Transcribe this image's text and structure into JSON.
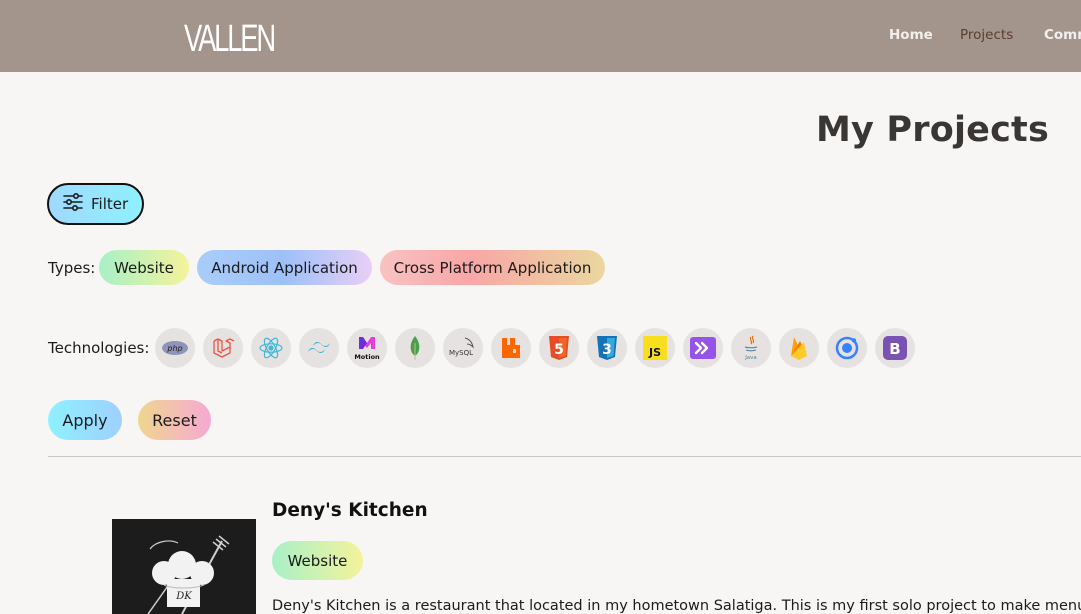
{
  "brand": {
    "logo_text": "VALLEN"
  },
  "nav": {
    "items": [
      {
        "label": "Home",
        "active": false
      },
      {
        "label": "Projects",
        "active": true
      },
      {
        "label": "Comm",
        "active": false
      }
    ]
  },
  "page": {
    "title": "My Projects"
  },
  "filter": {
    "button_label": "Filter",
    "types_label": "Types:",
    "types": [
      {
        "label": "Website"
      },
      {
        "label": "Android Application"
      },
      {
        "label": "Cross Platform Application"
      }
    ],
    "technologies_label": "Technologies:",
    "technologies": [
      {
        "icon": "php-icon",
        "text": "php"
      },
      {
        "icon": "laravel-icon"
      },
      {
        "icon": "react-icon"
      },
      {
        "icon": "tailwind-icon"
      },
      {
        "icon": "motion-icon",
        "text": "Motion"
      },
      {
        "icon": "mongodb-icon"
      },
      {
        "icon": "mysql-icon",
        "text": "MySQL"
      },
      {
        "icon": "rabbitmq-icon"
      },
      {
        "icon": "html5-icon",
        "text": "5"
      },
      {
        "icon": "css3-icon",
        "text": "3"
      },
      {
        "icon": "javascript-icon",
        "text": "JS"
      },
      {
        "icon": "inertia-icon"
      },
      {
        "icon": "java-icon",
        "text": "Java"
      },
      {
        "icon": "firebase-icon"
      },
      {
        "icon": "ionic-icon"
      },
      {
        "icon": "bootstrap-icon",
        "text": "B"
      }
    ],
    "apply_label": "Apply",
    "reset_label": "Reset"
  },
  "projects": [
    {
      "title": "Deny's Kitchen",
      "type": "Website",
      "thumbnail_text": "DK",
      "description": "Deny's Kitchen is a restaurant that located in my hometown Salatiga. This is my first solo project to make menu li"
    }
  ],
  "colors": {
    "navbar": "#a3948c",
    "nav_active": "#5b3f30",
    "background": "#f8f6f5",
    "title": "#3a3633"
  }
}
